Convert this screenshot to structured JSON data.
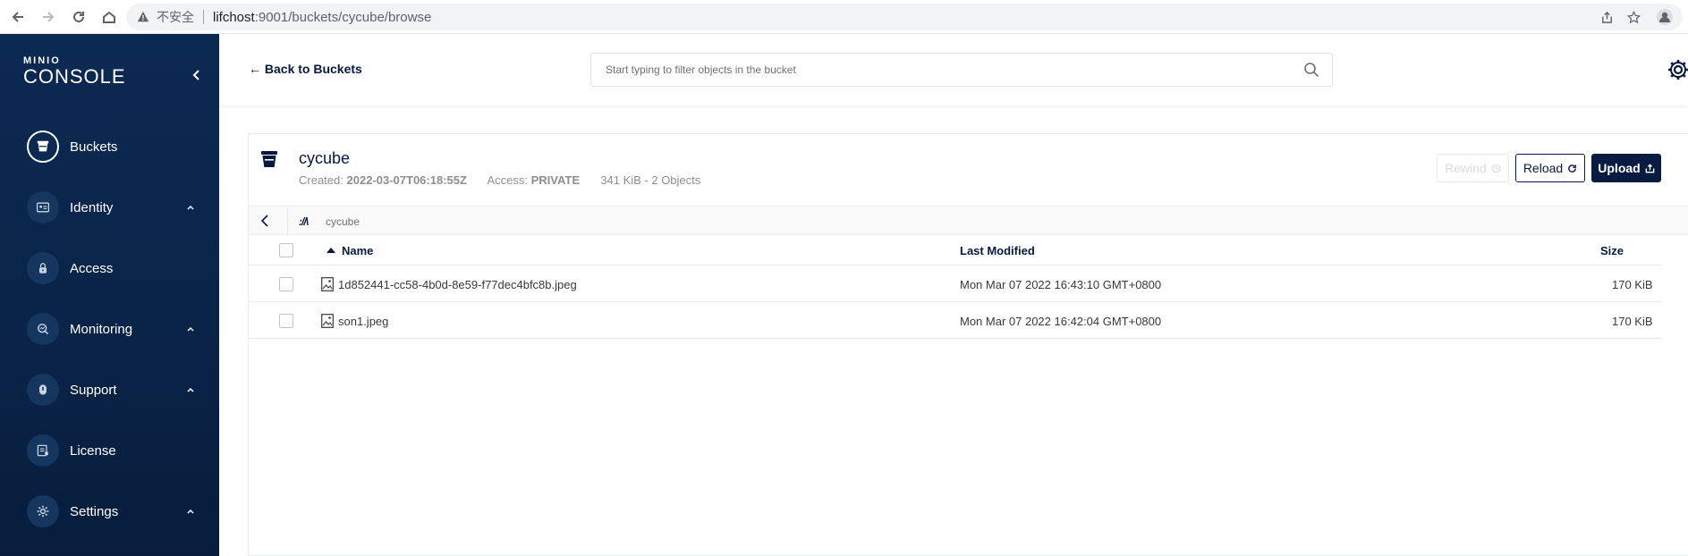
{
  "browser": {
    "insecure_label": "不安全",
    "url_host": "lifchost",
    "url_rest": ":9001/buckets/cycube/browse"
  },
  "sidebar": {
    "logo_top": "MINIO",
    "logo_bottom": "CONSOLE",
    "items": [
      {
        "label": "Buckets",
        "icon": "bucket-icon",
        "expandable": false,
        "active": true
      },
      {
        "label": "Identity",
        "icon": "identity-card-icon",
        "expandable": true
      },
      {
        "label": "Access",
        "icon": "lock-icon",
        "expandable": false
      },
      {
        "label": "Monitoring",
        "icon": "monitoring-search-icon",
        "expandable": true
      },
      {
        "label": "Support",
        "icon": "support-icon",
        "expandable": true
      },
      {
        "label": "License",
        "icon": "license-icon",
        "expandable": false
      },
      {
        "label": "Settings",
        "icon": "gear-icon",
        "expandable": true
      }
    ]
  },
  "header": {
    "back_label": "← Back to Buckets",
    "search_placeholder": "Start typing to filter objects in the bucket"
  },
  "bucket": {
    "name": "cycube",
    "created_label": "Created:",
    "created_value": "2022-03-07T06:18:55Z",
    "access_label": "Access:",
    "access_value": "PRIVATE",
    "summary": "341 KiB - 2 Objects"
  },
  "actions": {
    "rewind": "Rewind",
    "reload": "Reload",
    "upload": "Upload"
  },
  "breadcrumb": {
    "path": "cycube"
  },
  "table": {
    "columns": {
      "name": "Name",
      "modified": "Last Modified",
      "size": "Size"
    },
    "rows": [
      {
        "name": "1d852441-cc58-4b0d-8e59-f77dec4bfc8b.jpeg",
        "modified": "Mon Mar 07 2022 16:43:10 GMT+0800",
        "size": "170 KiB"
      },
      {
        "name": "son1.jpeg",
        "modified": "Mon Mar 07 2022 16:42:04 GMT+0800",
        "size": "170 KiB"
      }
    ]
  },
  "colors": {
    "sidebar_bg": "#0b2a52",
    "primary": "#081c42",
    "text": "#07193e",
    "muted": "#8e8e8e"
  }
}
